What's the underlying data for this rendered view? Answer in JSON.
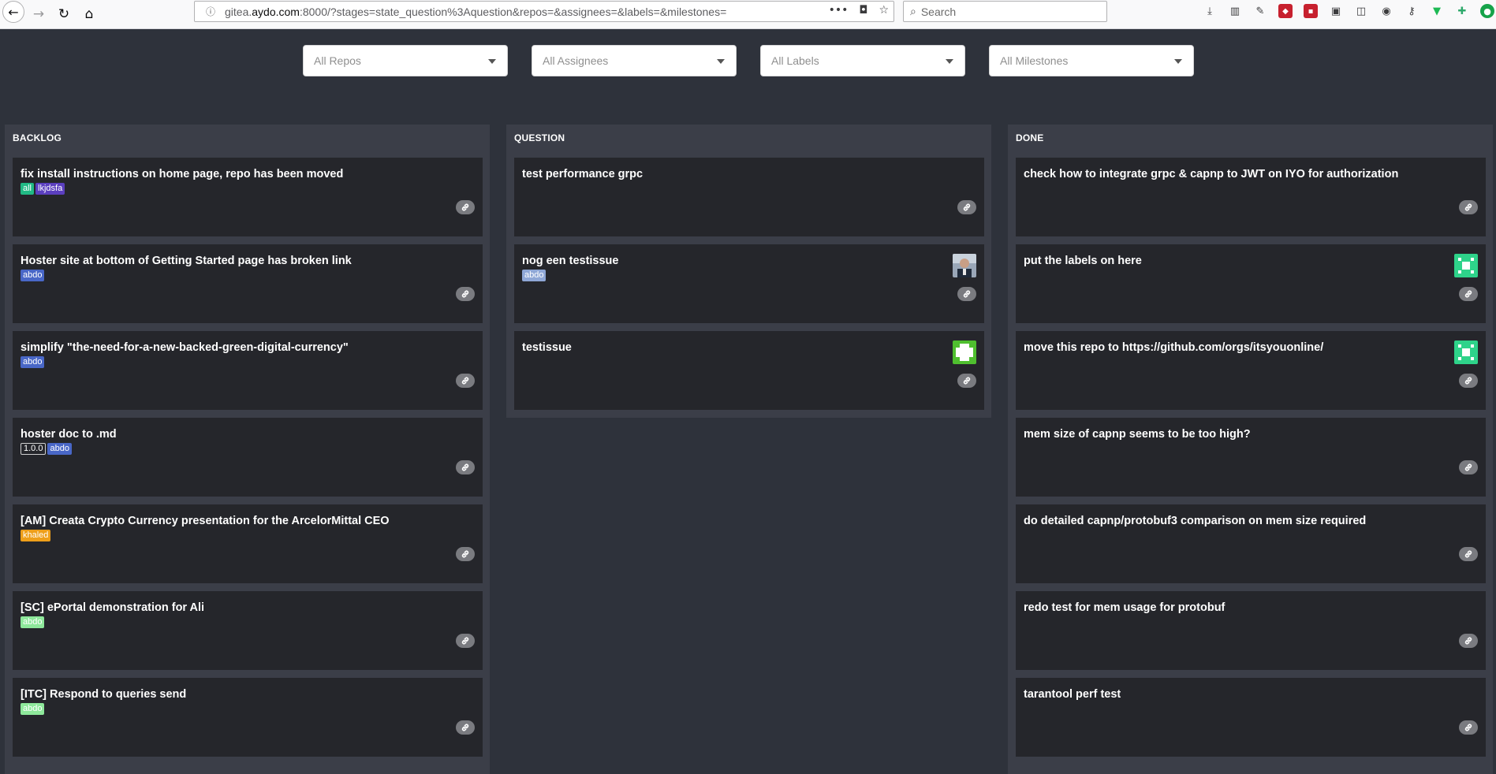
{
  "browser": {
    "url_prefix": "gitea.",
    "url_host": "aydo.com",
    "url_rest": ":8000/?stages=state_question%3Aquestion&repos=&assignees=&labels=&milestones=",
    "search_placeholder": "Search",
    "actions_more": "•••"
  },
  "filters": {
    "repos": "All Repos",
    "assignees": "All Assignees",
    "labels": "All Labels",
    "milestones": "All Milestones"
  },
  "columns": [
    {
      "title": "BACKLOG",
      "cards": [
        {
          "title": "fix install instructions on home page, repo has been moved",
          "labels": [
            {
              "text": "all",
              "color": "#21ba85"
            },
            {
              "text": "lkjdsfa",
              "color": "#5b3fbf"
            }
          ]
        },
        {
          "title": "Hoster site at bottom of Getting Started page has broken link",
          "labels": [
            {
              "text": "abdo",
              "color": "#4967c7"
            }
          ]
        },
        {
          "title": "simplify \"the-need-for-a-new-backed-green-digital-currency\"",
          "labels": [
            {
              "text": "abdo",
              "color": "#4967c7"
            }
          ]
        },
        {
          "title": "hoster doc to .md",
          "labels": [
            {
              "text": "1.0.0",
              "color": "#25262b",
              "border": "#cfcfcf"
            },
            {
              "text": "abdo",
              "color": "#4967c7"
            }
          ]
        },
        {
          "title": "[AM] Creata Crypto Currency presentation for the ArcelorMittal CEO",
          "labels": [
            {
              "text": "khaled",
              "color": "#ee9f1a"
            }
          ]
        },
        {
          "title": "[SC] ePortal demonstration for Ali",
          "labels": [
            {
              "text": "abdo",
              "color": "#8ee89b"
            }
          ]
        },
        {
          "title": "[ITC] Respond to queries send",
          "labels": [
            {
              "text": "abdo",
              "color": "#8ee89b"
            }
          ]
        }
      ]
    },
    {
      "title": "QUESTION",
      "cards": [
        {
          "title": "test performance grpc",
          "labels": []
        },
        {
          "title": "nog een testissue",
          "labels": [
            {
              "text": "abdo",
              "color": "#8fa7d6"
            }
          ],
          "avatar": "photo"
        },
        {
          "title": "testissue",
          "labels": [],
          "avatar": "green-pattern"
        }
      ]
    },
    {
      "title": "DONE",
      "cards": [
        {
          "title": "check how to integrate grpc & capnp to JWT on IYO for authorization",
          "labels": []
        },
        {
          "title": "put the labels on here",
          "labels": [],
          "avatar": "teal-pattern"
        },
        {
          "title": "move this repo to https://github.com/orgs/itsyouonline/",
          "labels": [],
          "avatar": "teal-pattern"
        },
        {
          "title": "mem size of capnp seems to be too high?",
          "labels": []
        },
        {
          "title": "do detailed capnp/protobuf3 comparison on mem size required",
          "labels": []
        },
        {
          "title": "redo test for mem usage for protobuf",
          "labels": []
        },
        {
          "title": "tarantool perf test",
          "labels": []
        }
      ]
    }
  ]
}
